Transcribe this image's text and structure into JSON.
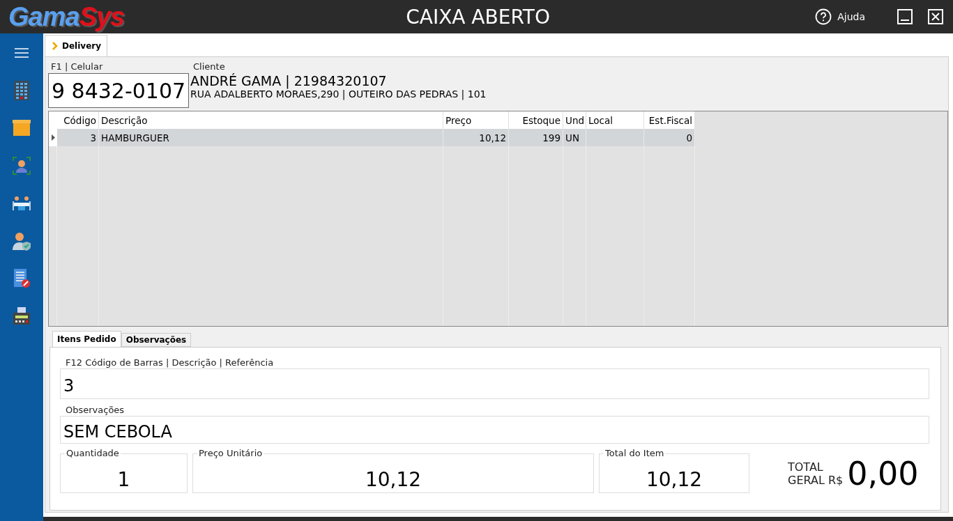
{
  "window": {
    "logo": {
      "first": "Gama",
      "second": "Sys"
    },
    "title": "CAIXA ABERTO",
    "help": "Ajuda"
  },
  "sidebar": {
    "items": [
      {
        "kind": "building"
      },
      {
        "kind": "box"
      },
      {
        "kind": "person"
      },
      {
        "kind": "table"
      },
      {
        "kind": "shield"
      },
      {
        "kind": "document"
      },
      {
        "kind": "register"
      }
    ]
  },
  "page_tab": {
    "label": "Delivery",
    "selected": true
  },
  "phone": {
    "label": "F1 | Celular",
    "value": "9 8432-0107"
  },
  "client": {
    "label": "Cliente",
    "name": "ANDRÉ GAMA | 21984320107",
    "address": "RUA ADALBERTO MORAES,290 | OUTEIRO DAS PEDRAS  | 101"
  },
  "table": {
    "columns": [
      {
        "label": "Código",
        "kind": "number"
      },
      {
        "label": "Descrição",
        "kind": "text"
      },
      {
        "label": "Preço",
        "kind": "text"
      },
      {
        "label": "Estoque",
        "kind": "number"
      },
      {
        "label": "Und",
        "kind": "text"
      },
      {
        "label": "Local",
        "kind": "text"
      },
      {
        "label": "Est.Fiscal",
        "kind": "number"
      }
    ],
    "rows": [
      {
        "selected": true,
        "cells": [
          "3",
          "HAMBURGUER",
          "10,12",
          "199",
          "UN",
          "",
          "0"
        ]
      }
    ]
  },
  "tabs": [
    {
      "label": "Itens Pedido",
      "selected": true
    },
    {
      "label": "Observações",
      "selected": false
    }
  ],
  "search": {
    "label": "F12 Código de Barras | Descrição | Referência",
    "value": "3"
  },
  "notes": {
    "label": "Observações",
    "value": "SEM CEBOLA"
  },
  "quantity": {
    "label": "Quantidade",
    "value": "1"
  },
  "unit_price": {
    "label": "Preço Unitário",
    "value": "10,12"
  },
  "item_total": {
    "label": "Total do Item",
    "value": "10,12"
  },
  "grand_total": {
    "label_1": "TOTAL",
    "label_2": "GERAL R$",
    "value": "0,00"
  }
}
